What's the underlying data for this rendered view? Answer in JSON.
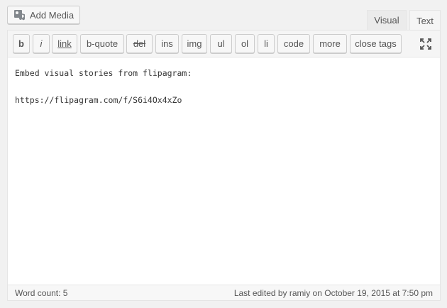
{
  "media": {
    "add_label": "Add Media",
    "icon": "add-media-icon"
  },
  "tabs": {
    "visual": "Visual",
    "text": "Text"
  },
  "toolbar": {
    "buttons": [
      "b",
      "i",
      "link",
      "b-quote",
      "del",
      "ins",
      "img",
      "ul",
      "ol",
      "li",
      "code",
      "more",
      "close tags"
    ],
    "fullscreen_icon": "fullscreen-icon"
  },
  "content": {
    "line1": "Embed visual stories from flipagram:",
    "line2": "",
    "line3": "https://flipagram.com/f/S6i4Ox4xZo"
  },
  "status": {
    "word_count": "Word count: 5",
    "last_edited": "Last edited by ramiy on October 19, 2015 at 7:50 pm"
  }
}
